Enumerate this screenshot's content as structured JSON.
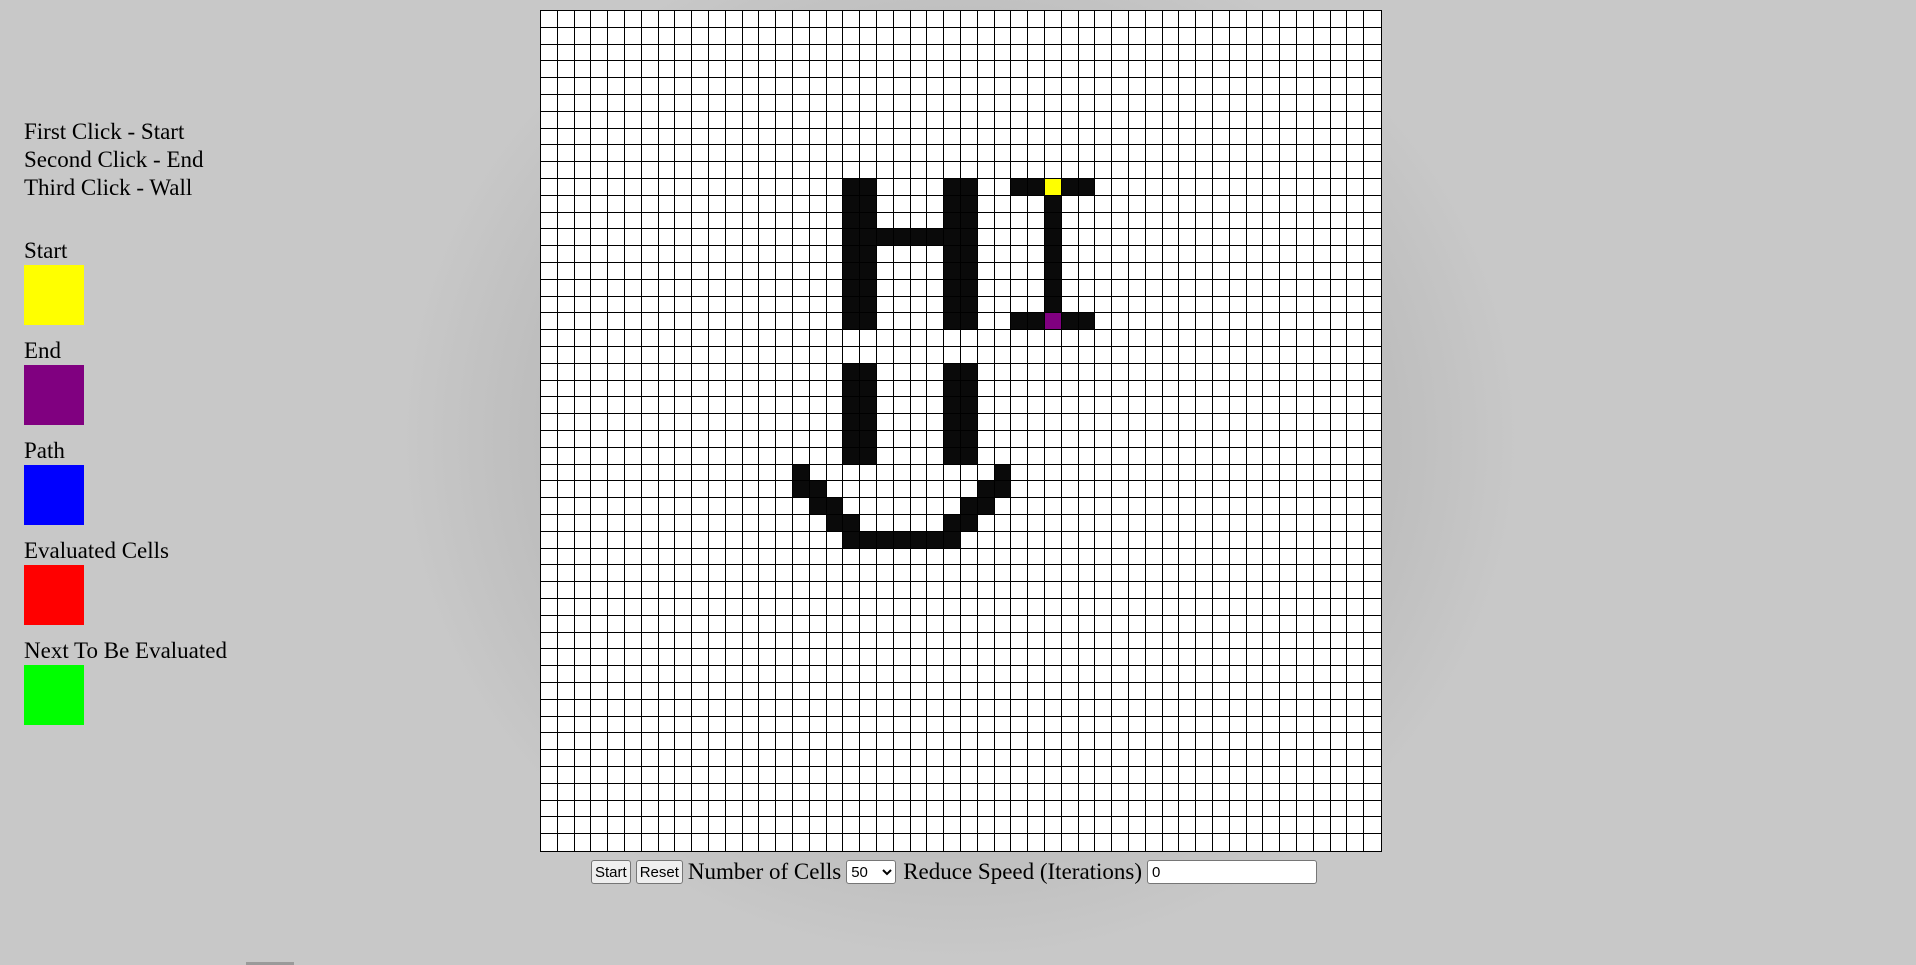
{
  "instructions": [
    "First Click - Start",
    "Second Click - End",
    "Third Click - Wall"
  ],
  "legend": [
    {
      "label": "Start",
      "color": "#ffff00"
    },
    {
      "label": "End",
      "color": "#800080"
    },
    {
      "label": "Path",
      "color": "#0000ff"
    },
    {
      "label": "Evaluated Cells",
      "color": "#ff0000"
    },
    {
      "label": "Next To Be Evaluated",
      "color": "#00ff00"
    }
  ],
  "grid": {
    "columns": 50,
    "rows": 50,
    "wall_color": "#0a0a0a",
    "empty_color": "#ffffff",
    "start": [
      10,
      30
    ],
    "end": [
      18,
      30
    ],
    "walls": [
      [
        10,
        18
      ],
      [
        10,
        19
      ],
      [
        10,
        24
      ],
      [
        10,
        25
      ],
      [
        10,
        28
      ],
      [
        10,
        29
      ],
      [
        10,
        31
      ],
      [
        10,
        32
      ],
      [
        11,
        18
      ],
      [
        11,
        19
      ],
      [
        11,
        24
      ],
      [
        11,
        25
      ],
      [
        11,
        30
      ],
      [
        12,
        18
      ],
      [
        12,
        19
      ],
      [
        12,
        24
      ],
      [
        12,
        25
      ],
      [
        12,
        30
      ],
      [
        13,
        18
      ],
      [
        13,
        19
      ],
      [
        13,
        20
      ],
      [
        13,
        21
      ],
      [
        13,
        22
      ],
      [
        13,
        23
      ],
      [
        13,
        24
      ],
      [
        13,
        25
      ],
      [
        13,
        30
      ],
      [
        14,
        18
      ],
      [
        14,
        19
      ],
      [
        14,
        24
      ],
      [
        14,
        25
      ],
      [
        14,
        30
      ],
      [
        15,
        18
      ],
      [
        15,
        19
      ],
      [
        15,
        24
      ],
      [
        15,
        25
      ],
      [
        15,
        30
      ],
      [
        16,
        18
      ],
      [
        16,
        19
      ],
      [
        16,
        24
      ],
      [
        16,
        25
      ],
      [
        16,
        30
      ],
      [
        17,
        18
      ],
      [
        17,
        19
      ],
      [
        17,
        24
      ],
      [
        17,
        25
      ],
      [
        17,
        30
      ],
      [
        18,
        18
      ],
      [
        18,
        19
      ],
      [
        18,
        24
      ],
      [
        18,
        25
      ],
      [
        18,
        28
      ],
      [
        18,
        29
      ],
      [
        18,
        31
      ],
      [
        18,
        32
      ],
      [
        21,
        18
      ],
      [
        21,
        19
      ],
      [
        21,
        24
      ],
      [
        21,
        25
      ],
      [
        22,
        18
      ],
      [
        22,
        19
      ],
      [
        22,
        24
      ],
      [
        22,
        25
      ],
      [
        23,
        18
      ],
      [
        23,
        19
      ],
      [
        23,
        24
      ],
      [
        23,
        25
      ],
      [
        24,
        18
      ],
      [
        24,
        19
      ],
      [
        24,
        24
      ],
      [
        24,
        25
      ],
      [
        25,
        18
      ],
      [
        25,
        19
      ],
      [
        25,
        24
      ],
      [
        25,
        25
      ],
      [
        26,
        18
      ],
      [
        26,
        19
      ],
      [
        26,
        24
      ],
      [
        26,
        25
      ],
      [
        27,
        15
      ],
      [
        27,
        27
      ],
      [
        28,
        15
      ],
      [
        28,
        16
      ],
      [
        28,
        26
      ],
      [
        28,
        27
      ],
      [
        29,
        16
      ],
      [
        29,
        17
      ],
      [
        29,
        25
      ],
      [
        29,
        26
      ],
      [
        30,
        17
      ],
      [
        30,
        18
      ],
      [
        30,
        24
      ],
      [
        30,
        25
      ],
      [
        31,
        18
      ],
      [
        31,
        19
      ],
      [
        31,
        20
      ],
      [
        31,
        21
      ],
      [
        31,
        22
      ],
      [
        31,
        23
      ],
      [
        31,
        24
      ]
    ]
  },
  "controls": {
    "start_label": "Start",
    "reset_label": "Reset",
    "cells_label": "Number of Cells",
    "cells_value": "50",
    "cells_options": [
      "50"
    ],
    "speed_label": "Reduce Speed (Iterations)",
    "speed_value": "0"
  }
}
